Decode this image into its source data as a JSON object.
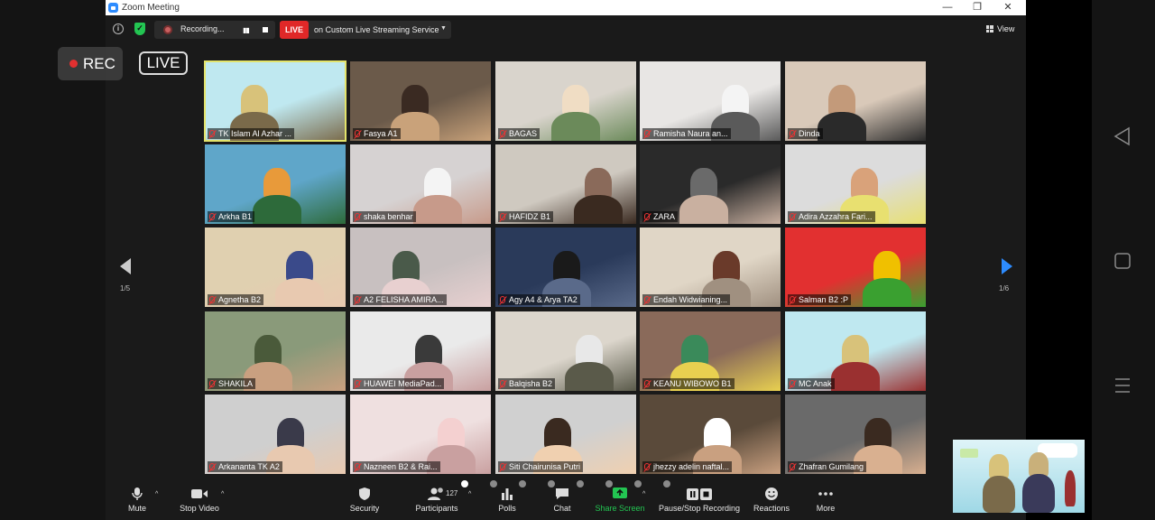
{
  "window": {
    "title": "Zoom Meeting",
    "minimize": "—",
    "restore": "❐",
    "close": "✕"
  },
  "topbar": {
    "info_icon": "info-icon",
    "shield_icon": "shield-icon",
    "recording_label": "Recording...",
    "live_badge": "LIVE",
    "live_text": "on Custom Live Streaming Service",
    "view_label": "View"
  },
  "overlay": {
    "rec": "REC",
    "live": "LIVE"
  },
  "pager": {
    "left": "1/5",
    "right": "1/6"
  },
  "participants": [
    {
      "name": "TK Islam Al Azhar ..."
    },
    {
      "name": "Fasya A1"
    },
    {
      "name": "BAGAS"
    },
    {
      "name": "Ramisha Naura an..."
    },
    {
      "name": "Dinda"
    },
    {
      "name": "Arkha B1"
    },
    {
      "name": "shaka benhar"
    },
    {
      "name": "HAFIDZ B1"
    },
    {
      "name": "ZARA"
    },
    {
      "name": "Adira Azzahra Fari..."
    },
    {
      "name": "Agnetha B2"
    },
    {
      "name": "A2 FELISHA AMIRA..."
    },
    {
      "name": "Agy A4 & Arya TA2"
    },
    {
      "name": "Endah Widwianing..."
    },
    {
      "name": "Salman B2 :P"
    },
    {
      "name": "SHAKILA"
    },
    {
      "name": "HUAWEI MediaPad..."
    },
    {
      "name": "Balqisha B2"
    },
    {
      "name": "KEANU WIBOWO B1"
    },
    {
      "name": "MC Anak"
    },
    {
      "name": "Arkananta TK A2"
    },
    {
      "name": "Nazneen B2 & Rai..."
    },
    {
      "name": "Siti Chairunisa Putri"
    },
    {
      "name": "jhezzy adelin naftal..."
    },
    {
      "name": "Zhafran Gumilang"
    }
  ],
  "toolbar": {
    "mute": "Mute",
    "stop_video": "Stop Video",
    "security": "Security",
    "participants": "Participants",
    "participants_count": "127",
    "polls": "Polls",
    "chat": "Chat",
    "share_screen": "Share Screen",
    "pause_stop_recording": "Pause/Stop Recording",
    "reactions": "Reactions",
    "more": "More"
  },
  "colors": {
    "accent": "#2d8cff",
    "share_green": "#23c552",
    "live_red": "#e02828",
    "active_speaker": "#e3e36b"
  }
}
